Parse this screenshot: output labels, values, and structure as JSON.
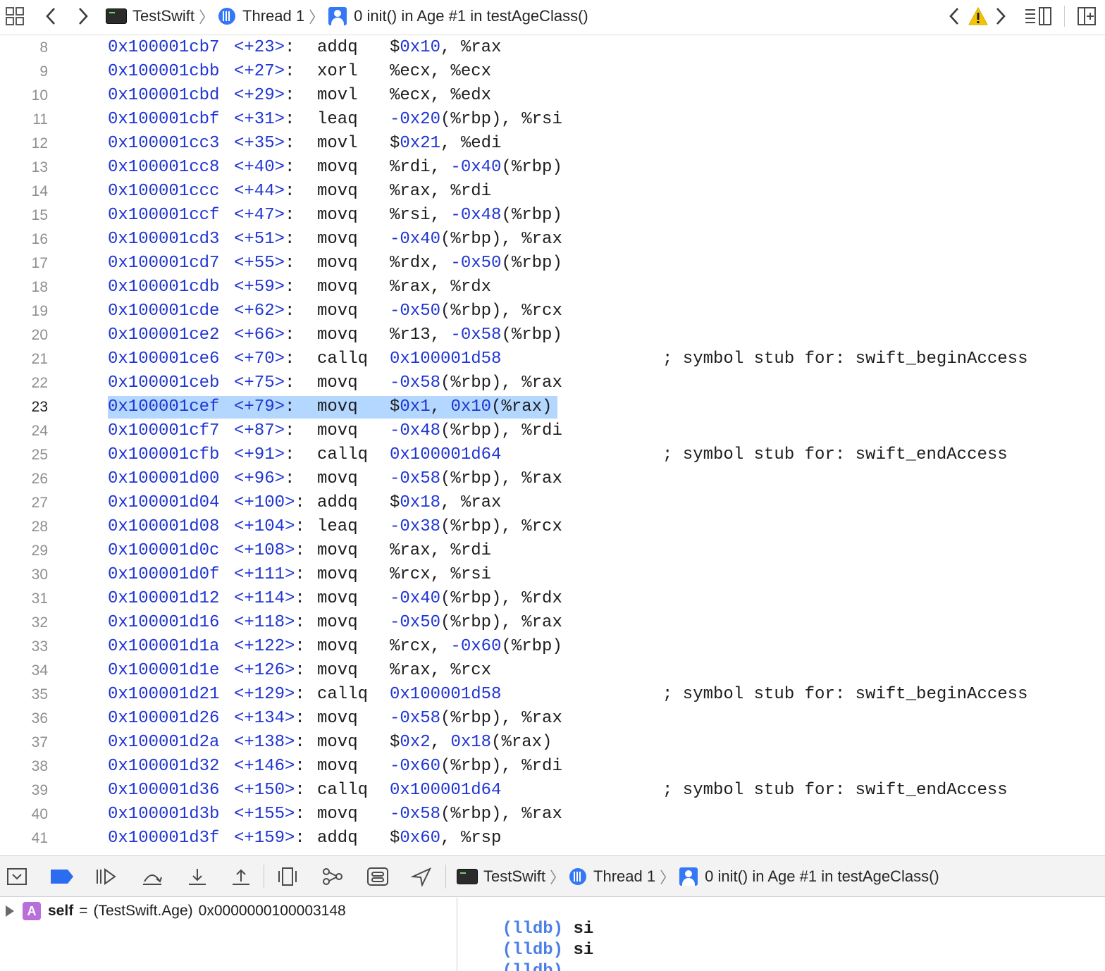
{
  "top_bar": {
    "project": "TestSwift",
    "thread": "Thread 1",
    "frame": "0 init() in Age #1 in testAgeClass()",
    "warning_color": "#f5c400"
  },
  "code": {
    "current_line": 23,
    "lines": [
      {
        "n": "8",
        "addr": "0x100001cb7",
        "off": "<+23>",
        "mnem": "addq",
        "ops": [
          [
            "$",
            "t"
          ],
          [
            "0x10",
            "n"
          ],
          [
            ", %rax",
            "t"
          ]
        ],
        "comment": ""
      },
      {
        "n": "9",
        "addr": "0x100001cbb",
        "off": "<+27>",
        "mnem": "xorl",
        "ops": [
          [
            "%ecx, %ecx",
            "t"
          ]
        ],
        "comment": ""
      },
      {
        "n": "10",
        "addr": "0x100001cbd",
        "off": "<+29>",
        "mnem": "movl",
        "ops": [
          [
            "%ecx, %edx",
            "t"
          ]
        ],
        "comment": ""
      },
      {
        "n": "11",
        "addr": "0x100001cbf",
        "off": "<+31>",
        "mnem": "leaq",
        "ops": [
          [
            "-0x20",
            "n"
          ],
          [
            "(%rbp), %rsi",
            "t"
          ]
        ],
        "comment": ""
      },
      {
        "n": "12",
        "addr": "0x100001cc3",
        "off": "<+35>",
        "mnem": "movl",
        "ops": [
          [
            "$",
            "t"
          ],
          [
            "0x21",
            "n"
          ],
          [
            ", %edi",
            "t"
          ]
        ],
        "comment": ""
      },
      {
        "n": "13",
        "addr": "0x100001cc8",
        "off": "<+40>",
        "mnem": "movq",
        "ops": [
          [
            "%rdi, ",
            "t"
          ],
          [
            "-0x40",
            "n"
          ],
          [
            "(%rbp)",
            "t"
          ]
        ],
        "comment": ""
      },
      {
        "n": "14",
        "addr": "0x100001ccc",
        "off": "<+44>",
        "mnem": "movq",
        "ops": [
          [
            "%rax, %rdi",
            "t"
          ]
        ],
        "comment": ""
      },
      {
        "n": "15",
        "addr": "0x100001ccf",
        "off": "<+47>",
        "mnem": "movq",
        "ops": [
          [
            "%rsi, ",
            "t"
          ],
          [
            "-0x48",
            "n"
          ],
          [
            "(%rbp)",
            "t"
          ]
        ],
        "comment": ""
      },
      {
        "n": "16",
        "addr": "0x100001cd3",
        "off": "<+51>",
        "mnem": "movq",
        "ops": [
          [
            "-0x40",
            "n"
          ],
          [
            "(%rbp), %rax",
            "t"
          ]
        ],
        "comment": ""
      },
      {
        "n": "17",
        "addr": "0x100001cd7",
        "off": "<+55>",
        "mnem": "movq",
        "ops": [
          [
            "%rdx, ",
            "t"
          ],
          [
            "-0x50",
            "n"
          ],
          [
            "(%rbp)",
            "t"
          ]
        ],
        "comment": ""
      },
      {
        "n": "18",
        "addr": "0x100001cdb",
        "off": "<+59>",
        "mnem": "movq",
        "ops": [
          [
            "%rax, %rdx",
            "t"
          ]
        ],
        "comment": ""
      },
      {
        "n": "19",
        "addr": "0x100001cde",
        "off": "<+62>",
        "mnem": "movq",
        "ops": [
          [
            "-0x50",
            "n"
          ],
          [
            "(%rbp), %rcx",
            "t"
          ]
        ],
        "comment": ""
      },
      {
        "n": "20",
        "addr": "0x100001ce2",
        "off": "<+66>",
        "mnem": "movq",
        "ops": [
          [
            "%r13, ",
            "t"
          ],
          [
            "-0x58",
            "n"
          ],
          [
            "(%rbp)",
            "t"
          ]
        ],
        "comment": ""
      },
      {
        "n": "21",
        "addr": "0x100001ce6",
        "off": "<+70>",
        "mnem": "callq",
        "ops": [
          [
            "0x100001d58",
            "n"
          ]
        ],
        "comment": "; symbol stub for: swift_beginAccess"
      },
      {
        "n": "22",
        "addr": "0x100001ceb",
        "off": "<+75>",
        "mnem": "movq",
        "ops": [
          [
            "-0x58",
            "n"
          ],
          [
            "(%rbp), %rax",
            "t"
          ]
        ],
        "comment": ""
      },
      {
        "n": "23",
        "addr": "0x100001cef",
        "off": "<+79>",
        "mnem": "movq",
        "ops": [
          [
            "$",
            "t"
          ],
          [
            "0x1",
            "n"
          ],
          [
            ", ",
            "t"
          ],
          [
            "0x10",
            "n"
          ],
          [
            "(%rax)",
            "t"
          ]
        ],
        "comment": ""
      },
      {
        "n": "24",
        "addr": "0x100001cf7",
        "off": "<+87>",
        "mnem": "movq",
        "ops": [
          [
            "-0x48",
            "n"
          ],
          [
            "(%rbp), %rdi",
            "t"
          ]
        ],
        "comment": ""
      },
      {
        "n": "25",
        "addr": "0x100001cfb",
        "off": "<+91>",
        "mnem": "callq",
        "ops": [
          [
            "0x100001d64",
            "n"
          ]
        ],
        "comment": "; symbol stub for: swift_endAccess"
      },
      {
        "n": "26",
        "addr": "0x100001d00",
        "off": "<+96>",
        "mnem": "movq",
        "ops": [
          [
            "-0x58",
            "n"
          ],
          [
            "(%rbp), %rax",
            "t"
          ]
        ],
        "comment": ""
      },
      {
        "n": "27",
        "addr": "0x100001d04",
        "off": "<+100>",
        "mnem": "addq",
        "ops": [
          [
            "$",
            "t"
          ],
          [
            "0x18",
            "n"
          ],
          [
            ", %rax",
            "t"
          ]
        ],
        "comment": ""
      },
      {
        "n": "28",
        "addr": "0x100001d08",
        "off": "<+104>",
        "mnem": "leaq",
        "ops": [
          [
            "-0x38",
            "n"
          ],
          [
            "(%rbp), %rcx",
            "t"
          ]
        ],
        "comment": ""
      },
      {
        "n": "29",
        "addr": "0x100001d0c",
        "off": "<+108>",
        "mnem": "movq",
        "ops": [
          [
            "%rax, %rdi",
            "t"
          ]
        ],
        "comment": ""
      },
      {
        "n": "30",
        "addr": "0x100001d0f",
        "off": "<+111>",
        "mnem": "movq",
        "ops": [
          [
            "%rcx, %rsi",
            "t"
          ]
        ],
        "comment": ""
      },
      {
        "n": "31",
        "addr": "0x100001d12",
        "off": "<+114>",
        "mnem": "movq",
        "ops": [
          [
            "-0x40",
            "n"
          ],
          [
            "(%rbp), %rdx",
            "t"
          ]
        ],
        "comment": ""
      },
      {
        "n": "32",
        "addr": "0x100001d16",
        "off": "<+118>",
        "mnem": "movq",
        "ops": [
          [
            "-0x50",
            "n"
          ],
          [
            "(%rbp), %rax",
            "t"
          ]
        ],
        "comment": ""
      },
      {
        "n": "33",
        "addr": "0x100001d1a",
        "off": "<+122>",
        "mnem": "movq",
        "ops": [
          [
            "%rcx, ",
            "t"
          ],
          [
            "-0x60",
            "n"
          ],
          [
            "(%rbp)",
            "t"
          ]
        ],
        "comment": ""
      },
      {
        "n": "34",
        "addr": "0x100001d1e",
        "off": "<+126>",
        "mnem": "movq",
        "ops": [
          [
            "%rax, %rcx",
            "t"
          ]
        ],
        "comment": ""
      },
      {
        "n": "35",
        "addr": "0x100001d21",
        "off": "<+129>",
        "mnem": "callq",
        "ops": [
          [
            "0x100001d58",
            "n"
          ]
        ],
        "comment": "; symbol stub for: swift_beginAccess"
      },
      {
        "n": "36",
        "addr": "0x100001d26",
        "off": "<+134>",
        "mnem": "movq",
        "ops": [
          [
            "-0x58",
            "n"
          ],
          [
            "(%rbp), %rax",
            "t"
          ]
        ],
        "comment": ""
      },
      {
        "n": "37",
        "addr": "0x100001d2a",
        "off": "<+138>",
        "mnem": "movq",
        "ops": [
          [
            "$",
            "t"
          ],
          [
            "0x2",
            "n"
          ],
          [
            ", ",
            "t"
          ],
          [
            "0x18",
            "n"
          ],
          [
            "(%rax)",
            "t"
          ]
        ],
        "comment": ""
      },
      {
        "n": "38",
        "addr": "0x100001d32",
        "off": "<+146>",
        "mnem": "movq",
        "ops": [
          [
            "-0x60",
            "n"
          ],
          [
            "(%rbp), %rdi",
            "t"
          ]
        ],
        "comment": ""
      },
      {
        "n": "39",
        "addr": "0x100001d36",
        "off": "<+150>",
        "mnem": "callq",
        "ops": [
          [
            "0x100001d64",
            "n"
          ]
        ],
        "comment": "; symbol stub for: swift_endAccess"
      },
      {
        "n": "40",
        "addr": "0x100001d3b",
        "off": "<+155>",
        "mnem": "movq",
        "ops": [
          [
            "-0x58",
            "n"
          ],
          [
            "(%rbp), %rax",
            "t"
          ]
        ],
        "comment": ""
      },
      {
        "n": "41",
        "addr": "0x100001d3f",
        "off": "<+159>",
        "mnem": "addq",
        "ops": [
          [
            "$",
            "t"
          ],
          [
            "0x60",
            "n"
          ],
          [
            ", %rsp",
            "t"
          ]
        ],
        "comment": ""
      }
    ]
  },
  "debug_bar": {
    "project": "TestSwift",
    "thread": "Thread 1",
    "frame": "0 init() in Age #1 in testAgeClass()",
    "accent_color": "#2b6cf0"
  },
  "variables": {
    "badge": "A",
    "name": "self",
    "equals": "=",
    "type": "(TestSwift.Age)",
    "value": "0x0000000100003148"
  },
  "console": {
    "lines": [
      {
        "prompt": "(lldb)",
        "cmd": "si"
      },
      {
        "prompt": "(lldb)",
        "cmd": "si"
      },
      {
        "prompt": "(lldb)",
        "cmd": ""
      }
    ]
  }
}
